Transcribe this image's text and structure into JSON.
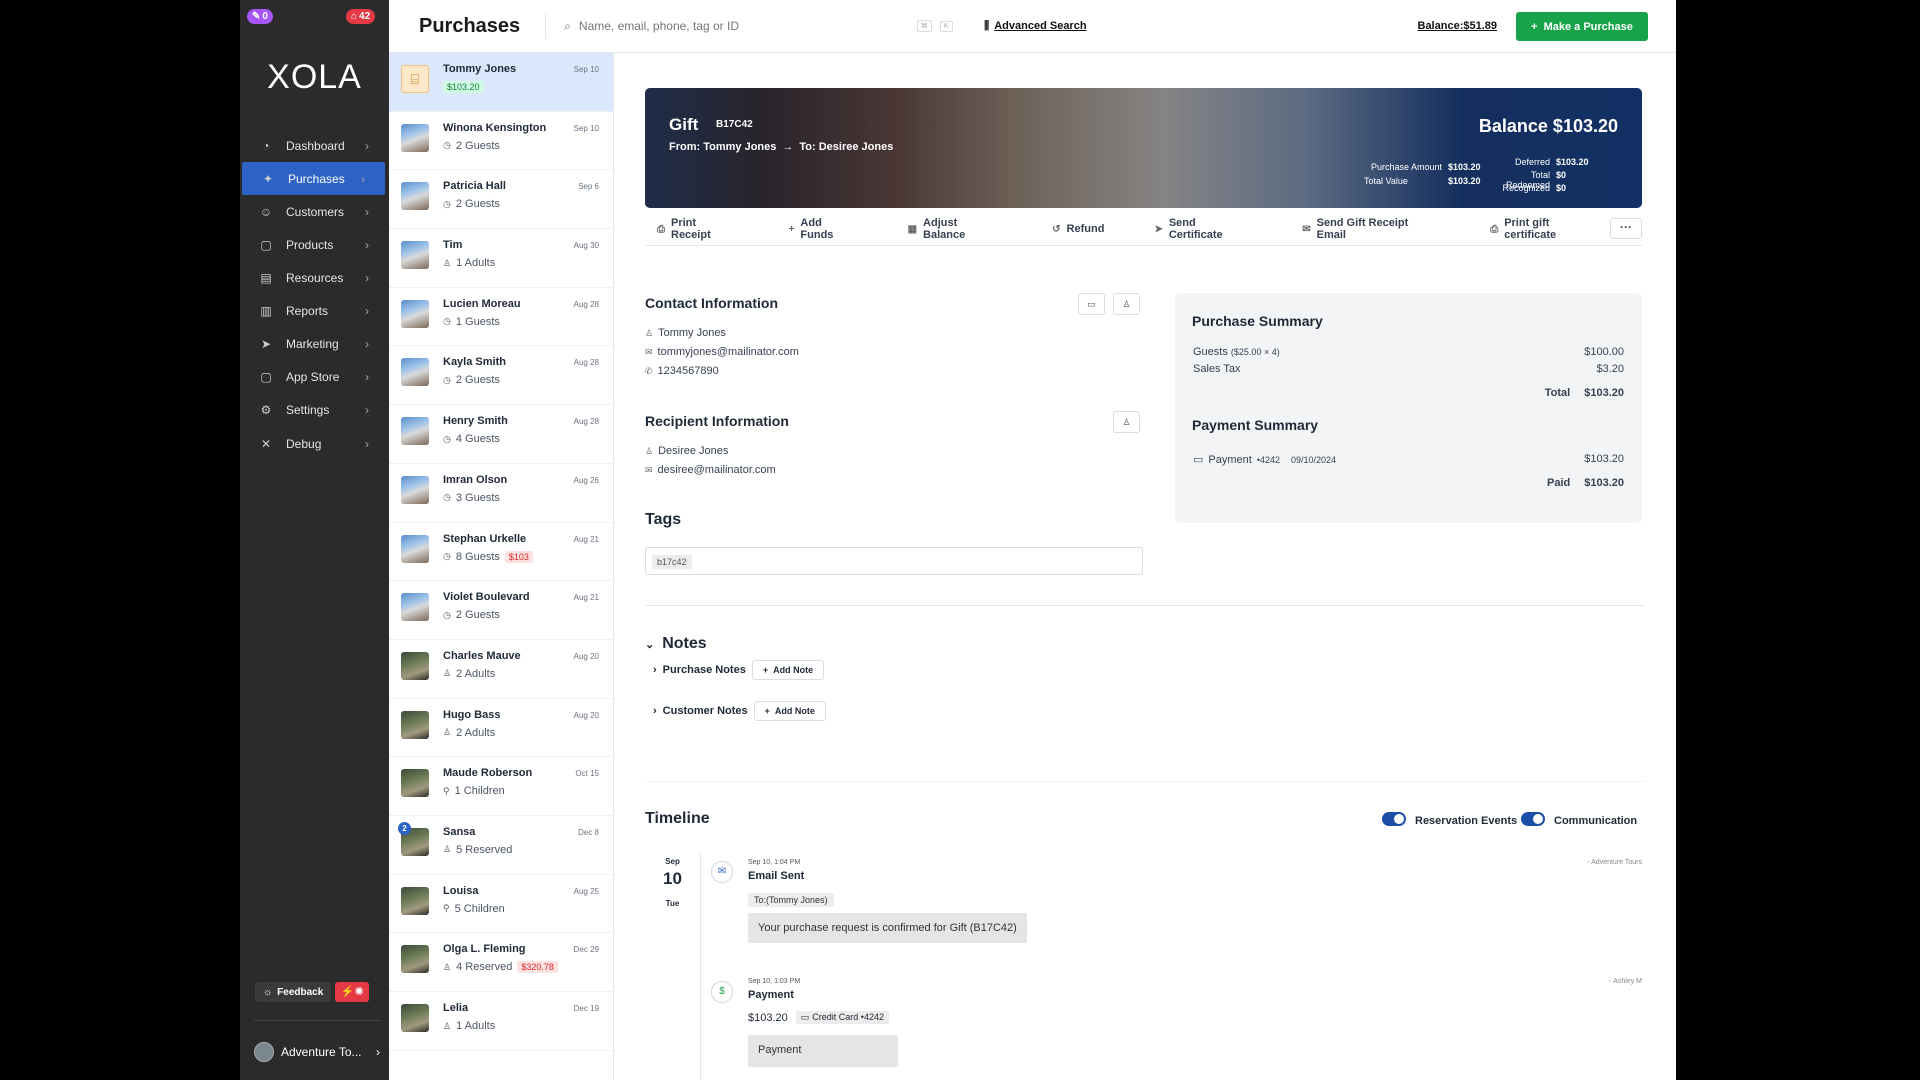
{
  "sidebar": {
    "badge_left": "0",
    "badge_right": "42",
    "logo": "XOLA",
    "nav": [
      {
        "label": "Dashboard",
        "icon": "dashboard-icon",
        "glyph": "◔"
      },
      {
        "label": "Purchases",
        "icon": "purchases-icon",
        "glyph": "✦"
      },
      {
        "label": "Customers",
        "icon": "customers-icon",
        "glyph": "☺"
      },
      {
        "label": "Products",
        "icon": "products-icon",
        "glyph": "▢"
      },
      {
        "label": "Resources",
        "icon": "resources-icon",
        "glyph": "▤"
      },
      {
        "label": "Reports",
        "icon": "reports-icon",
        "glyph": "▥"
      },
      {
        "label": "Marketing",
        "icon": "marketing-icon",
        "glyph": "➤"
      },
      {
        "label": "App Store",
        "icon": "app-store-icon",
        "glyph": "▢"
      },
      {
        "label": "Settings",
        "icon": "settings-icon",
        "glyph": "⚙"
      },
      {
        "label": "Debug",
        "icon": "debug-icon",
        "glyph": "✕"
      }
    ],
    "active": "Purchases",
    "feedback": "Feedback",
    "account": "Adventure To..."
  },
  "topbar": {
    "title": "Purchases",
    "search_placeholder": "Name, email, phone, tag or ID",
    "kbd1": "⌘",
    "kbd2": "K",
    "advanced": "Advanced Search",
    "balance": "Balance:$51.89",
    "make": "Make a Purchase"
  },
  "list": [
    {
      "name": "Tommy Jones",
      "date": "Sep 10",
      "sub": "",
      "tag_green": "$103.20",
      "thumb": "gift",
      "selected": true
    },
    {
      "name": "Winona Kensington",
      "date": "Sep 10",
      "sub": "2 Guests",
      "icon": "◷",
      "thumb": "bldg"
    },
    {
      "name": "Patricia Hall",
      "date": "Sep 6",
      "sub": "2 Guests",
      "icon": "◷",
      "thumb": "bldg"
    },
    {
      "name": "Tim",
      "date": "Aug 30",
      "sub": "1 Adults",
      "icon": "♙",
      "thumb": "bldg"
    },
    {
      "name": "Lucien Moreau",
      "date": "Aug 28",
      "sub": "1 Guests",
      "icon": "◷",
      "thumb": "bldg"
    },
    {
      "name": "Kayla Smith",
      "date": "Aug 28",
      "sub": "2 Guests",
      "icon": "◷",
      "thumb": "bldg"
    },
    {
      "name": "Henry Smith",
      "date": "Aug 28",
      "sub": "4 Guests",
      "icon": "◷",
      "thumb": "bldg"
    },
    {
      "name": "Imran Olson",
      "date": "Aug 26",
      "sub": "3 Guests",
      "icon": "◷",
      "thumb": "bldg"
    },
    {
      "name": "Stephan Urkelle",
      "date": "Aug 21",
      "sub": "8 Guests",
      "icon": "◷",
      "tag_red": "$103",
      "thumb": "bldg"
    },
    {
      "name": "Violet Boulevard",
      "date": "Aug 21",
      "sub": "2 Guests",
      "icon": "◷",
      "thumb": "bldg"
    },
    {
      "name": "Charles Mauve",
      "date": "Aug 20",
      "sub": "2 Adults",
      "icon": "♙",
      "thumb": "dark"
    },
    {
      "name": "Hugo Bass",
      "date": "Aug 20",
      "sub": "2 Adults",
      "icon": "♙",
      "thumb": "dark"
    },
    {
      "name": "Maude Roberson",
      "date": "Oct 15",
      "sub": "1 Children",
      "icon": "⚲",
      "thumb": "dark"
    },
    {
      "name": "Sansa",
      "date": "Dec 8",
      "sub": "5 Reserved",
      "icon": "♙",
      "thumb": "dark",
      "notif": "2"
    },
    {
      "name": "Louisa",
      "date": "Aug 25",
      "sub": "5 Children",
      "icon": "⚲",
      "thumb": "dark"
    },
    {
      "name": "Olga L. Fleming",
      "date": "Dec 29",
      "sub": "4 Reserved",
      "icon": "♙",
      "tag_red": "$320.78",
      "thumb": "dark"
    },
    {
      "name": "Lelia",
      "date": "Dec 19",
      "sub": "1 Adults",
      "icon": "♙",
      "thumb": "dark"
    }
  ],
  "hero": {
    "title": "Gift",
    "id": "B17C42",
    "from": "From: Tommy Jones",
    "arrow": "→",
    "to": "To: Desiree Jones",
    "balance": "Balance $103.20",
    "purchase_amount_k": "Purchase Amount",
    "purchase_amount_v": "$103.20",
    "total_value_k": "Total Value",
    "total_value_v": "$103.20",
    "deferred_k": "Deferred",
    "deferred_v": "$103.20",
    "redeemed_k": "Total Redeemed",
    "redeemed_v": "$0",
    "recognized_k": "Recognized",
    "recognized_v": "$0"
  },
  "actions": [
    "Print Receipt",
    "Add Funds",
    "Adjust Balance",
    "Refund",
    "Send Certificate",
    "Send Gift Receipt Email",
    "Print gift certificate"
  ],
  "more": "···",
  "contact": {
    "heading": "Contact Information",
    "name": "Tommy Jones",
    "email": "tommyjones@mailinator.com",
    "phone": "1234567890"
  },
  "recipient": {
    "heading": "Recipient Information",
    "name": "Desiree Jones",
    "email": "desiree@mailinator.com"
  },
  "tags": {
    "heading": "Tags",
    "items": [
      "b17c42"
    ]
  },
  "summary": {
    "heading": "Purchase Summary",
    "guests_label": "Guests",
    "guests_detail": "($25.00 × 4)",
    "guests_value": "$100.00",
    "tax_label": "Sales Tax",
    "tax_value": "$3.20",
    "total_label": "Total",
    "total_value": "$103.20",
    "pay_heading": "Payment Summary",
    "pay_label": "Payment",
    "pay_card": "•4242",
    "pay_date": "09/10/2024",
    "pay_value": "$103.20",
    "paid_label": "Paid",
    "paid_value": "$103.20"
  },
  "notes": {
    "heading": "Notes",
    "purchase": "Purchase Notes",
    "customer": "Customer Notes",
    "add": "Add Note"
  },
  "timeline": {
    "heading": "Timeline",
    "toggle1": "Reservation Events",
    "toggle2": "Communication",
    "month": "Sep",
    "day": "10",
    "dow": "Tue",
    "e1_time": "Sep 10, 1:04 PM",
    "e1_title": "Email Sent",
    "e1_by": "- Adventure Tours",
    "e1_to": "To:(Tommy Jones)",
    "e1_msg": "Your purchase request is confirmed for Gift (B17C42)",
    "e2_time": "Sep 10, 1:03 PM",
    "e2_title": "Payment",
    "e2_by": "- Ashley M",
    "e2_amount": "$103.20",
    "e2_card": "Credit Card •4242",
    "e2_msg": "Payment"
  }
}
